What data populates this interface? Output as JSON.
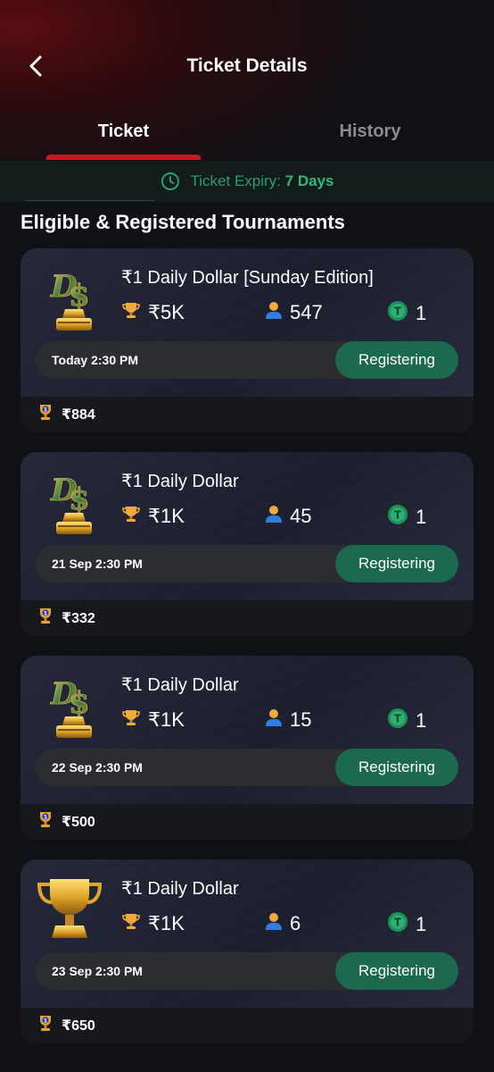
{
  "header": {
    "title": "Ticket Details"
  },
  "tabs": [
    {
      "label": "Ticket",
      "active": true
    },
    {
      "label": "History",
      "active": false
    }
  ],
  "expiry": {
    "label": "Ticket Expiry:",
    "value": "7 Days"
  },
  "section_title": "Eligible & Registered Tournaments",
  "tournaments": [
    {
      "name": "₹1 Daily Dollar [Sunday Edition]",
      "prize": "₹5K",
      "players": "547",
      "tickets": "1",
      "time": "Today 2:30 PM",
      "button": "Registering",
      "entry_prize": "₹884",
      "logo": "ds-trophy-icon"
    },
    {
      "name": "₹1 Daily Dollar",
      "prize": "₹1K",
      "players": "45",
      "tickets": "1",
      "time": "21 Sep 2:30 PM",
      "button": "Registering",
      "entry_prize": "₹332",
      "logo": "ds-trophy-icon"
    },
    {
      "name": "₹1 Daily Dollar",
      "prize": "₹1K",
      "players": "15",
      "tickets": "1",
      "time": "22 Sep 2:30 PM",
      "button": "Registering",
      "entry_prize": "₹500",
      "logo": "ds-trophy-icon"
    },
    {
      "name": "₹1 Daily Dollar",
      "prize": "₹1K",
      "players": "6",
      "tickets": "1",
      "time": "23 Sep 2:30 PM",
      "button": "Registering",
      "entry_prize": "₹650",
      "logo": "gold-cup-icon"
    }
  ],
  "colors": {
    "accent_red": "#c81a1e",
    "register_green": "#1b6a4e",
    "expiry_green": "#35b67f"
  }
}
